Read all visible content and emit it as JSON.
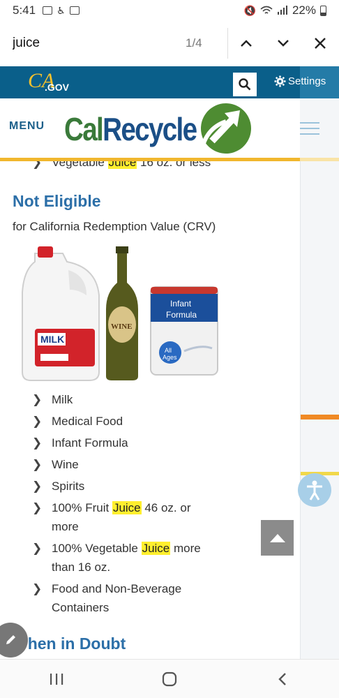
{
  "status_bar": {
    "time": "5:41",
    "battery": "22%",
    "icons": [
      "messages-icon",
      "accessibility-status-icon",
      "gallery-icon",
      "mute-icon",
      "wifi-icon",
      "signal-icon",
      "battery-icon"
    ]
  },
  "find_bar": {
    "query": "juice",
    "count": "1/4",
    "icons": [
      "chevron-up-icon",
      "chevron-down-icon",
      "close-icon"
    ]
  },
  "header": {
    "ca_logo": "CA",
    "ca_logo_suffix": ".GOV",
    "settings_label": "Settings",
    "menu_label": "MENU",
    "brand_cal": "Cal",
    "brand_recycle": "Recycle",
    "colors": {
      "top_bar": "#0a5f8a",
      "accent_gold": "#f1b72e",
      "brand_green": "#3a7a3a",
      "brand_blue": "#1b4f87"
    }
  },
  "content": {
    "cut_line": {
      "before": "Vegetable ",
      "match": "Juice",
      "after": " 16 oz. or less"
    },
    "not_eligible_heading": "Not Eligible",
    "subtitle": "for California Redemption Value (CRV)",
    "product_labels": {
      "milk": "MILK",
      "wine": "WINE",
      "formula_line1": "Infant",
      "formula_line2": "Formula",
      "formula_badge_line1": "All",
      "formula_badge_line2": "Ages"
    },
    "items": [
      {
        "text": "Milk"
      },
      {
        "text": "Medical Food"
      },
      {
        "text": "Infant Formula"
      },
      {
        "text": "Wine"
      },
      {
        "text": "Spirits"
      },
      {
        "before": "100% Fruit ",
        "match": "Juice",
        "after": " 46 oz. or more"
      },
      {
        "before": "100% Vegetable ",
        "match": "Juice",
        "after": " more than 16 oz."
      },
      {
        "text": "Food and Non-Beverage Containers"
      }
    ],
    "when_in_doubt_heading": "When in Doubt"
  },
  "nav_bar": {
    "icons": [
      "recent-apps-icon",
      "home-icon",
      "back-icon"
    ]
  }
}
